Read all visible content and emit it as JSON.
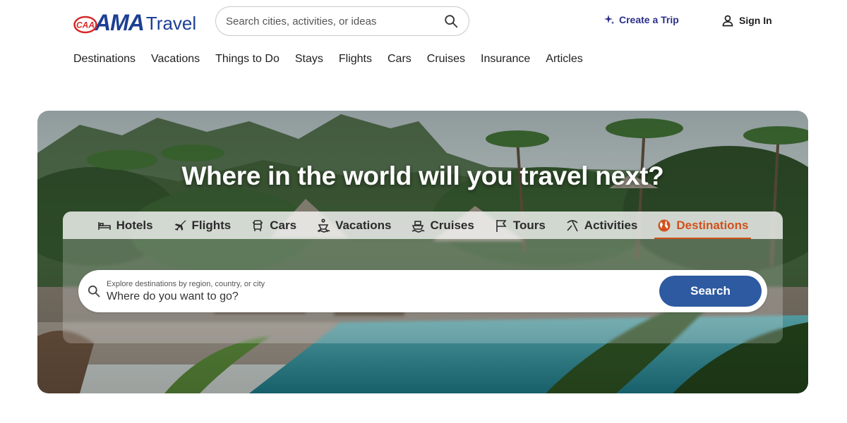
{
  "brand": {
    "logo_caa": "CAA",
    "logo_ama": "AMA",
    "logo_travel": "Travel",
    "primary_color": "#1c3f94",
    "accent_color": "#d2511d"
  },
  "header": {
    "search_placeholder": "Search cities, activities, or ideas",
    "search_icon": "search-icon",
    "create_trip_label": "Create a Trip",
    "create_trip_icon": "sparkle-icon",
    "sign_in_label": "Sign In",
    "sign_in_icon": "user-icon"
  },
  "nav": {
    "items": [
      {
        "label": "Destinations"
      },
      {
        "label": "Vacations"
      },
      {
        "label": "Things to Do"
      },
      {
        "label": "Stays"
      },
      {
        "label": "Flights"
      },
      {
        "label": "Cars"
      },
      {
        "label": "Cruises"
      },
      {
        "label": "Insurance"
      },
      {
        "label": "Articles"
      }
    ]
  },
  "hero": {
    "title": "Where in the world will you travel next?",
    "tabs": [
      {
        "label": "Hotels",
        "icon": "bed-icon"
      },
      {
        "label": "Flights",
        "icon": "plane-icon"
      },
      {
        "label": "Cars",
        "icon": "car-icon"
      },
      {
        "label": "Vacations",
        "icon": "beach-chair-icon"
      },
      {
        "label": "Cruises",
        "icon": "ship-icon"
      },
      {
        "label": "Tours",
        "icon": "flag-icon"
      },
      {
        "label": "Activities",
        "icon": "pickaxe-icon"
      },
      {
        "label": "Destinations",
        "icon": "globe-icon",
        "active": true
      }
    ],
    "search": {
      "label": "Explore destinations by region, country, or city",
      "placeholder": "Where do you want to go?",
      "button_label": "Search"
    }
  }
}
